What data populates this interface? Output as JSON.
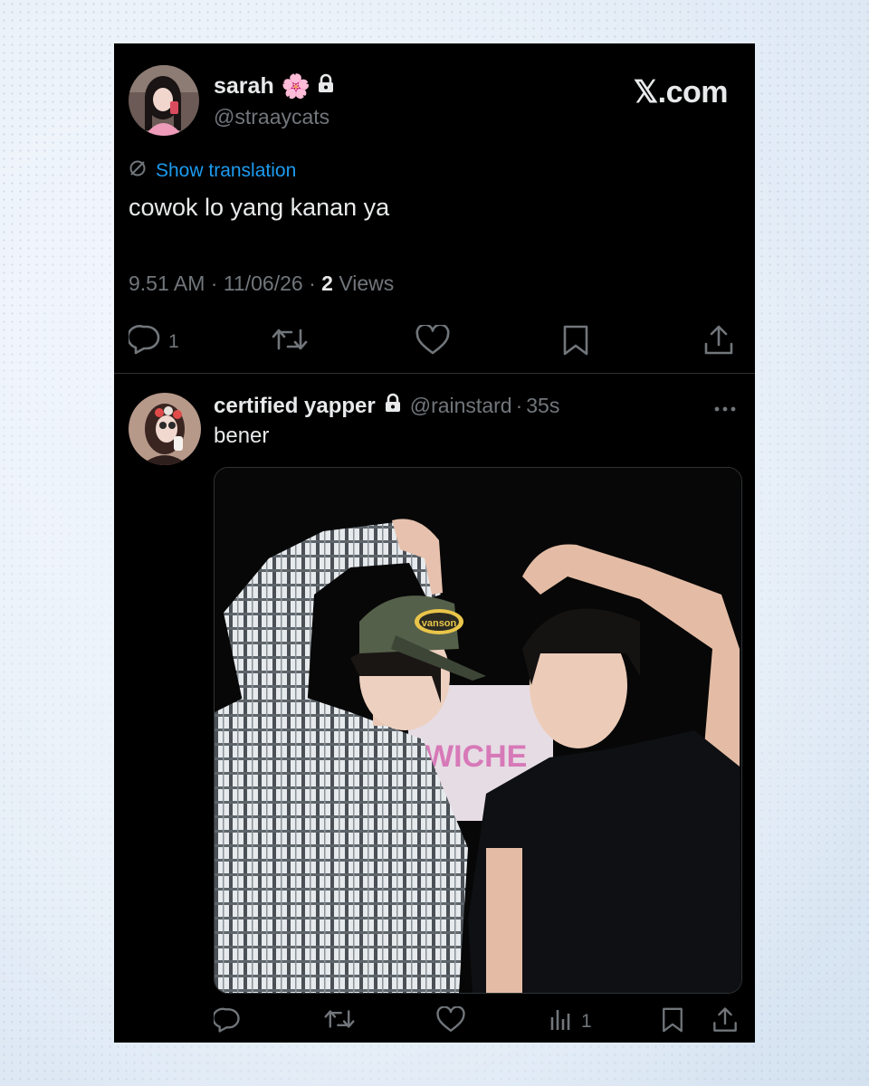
{
  "brand": "𝕏.com",
  "main_tweet": {
    "author_name": "sarah",
    "author_emoji": "🌸",
    "author_handle": "@straaycats",
    "translate_label": "Show translation",
    "text": "cowok lo yang kanan ya",
    "time": "9.51 AM",
    "date": "11/06/26",
    "views_count": "2",
    "views_label": "Views",
    "reply_count": "1"
  },
  "reply_tweet": {
    "author_name": "certified yapper",
    "author_handle": "@rainstard",
    "age": "35s",
    "text": "bener",
    "views_count": "1",
    "photo_text": {
      "cap_logo": "vanson",
      "shirt_text": "WICHE"
    }
  },
  "colors": {
    "background": "#000000",
    "text": "#e7e9ea",
    "muted": "#71767b",
    "link": "#1d9bf0"
  }
}
